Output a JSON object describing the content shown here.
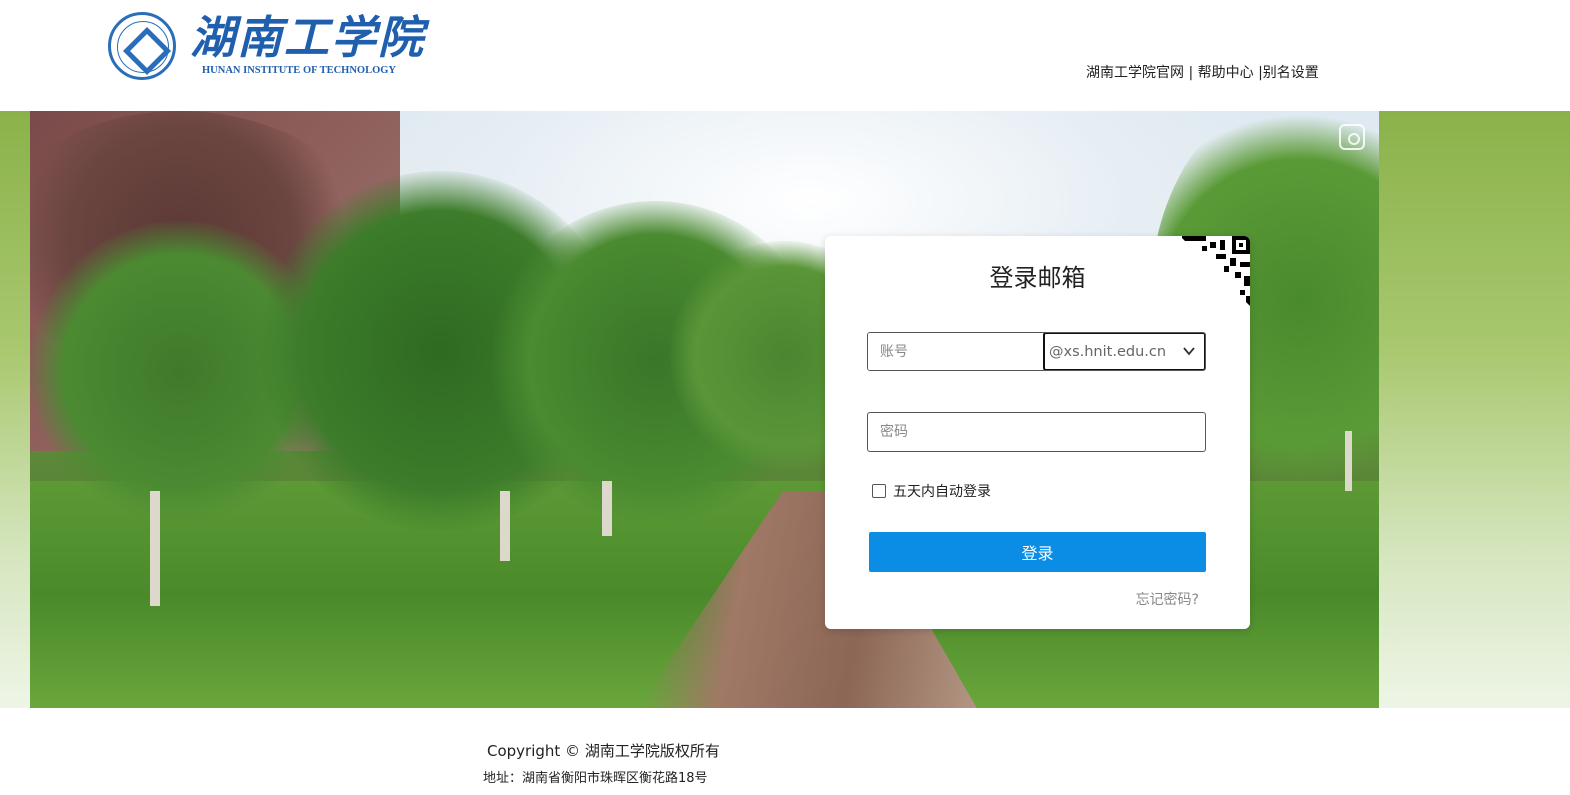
{
  "header": {
    "logo_cn": "湖南工学院",
    "logo_en": "HUNAN INSTITUTE OF TECHNOLOGY",
    "links": {
      "official_site": "湖南工学院官网",
      "sep1": " | ",
      "help_center": "帮助中心",
      "sep2": " |",
      "alias_settings": "别名设置"
    }
  },
  "login": {
    "title": "登录邮箱",
    "account_placeholder": "账号",
    "domain_selected": "@xs.hnit.edu.cn",
    "password_placeholder": "密码",
    "remember_label": "五天内自动登录",
    "login_button": "登录",
    "forgot_password": "忘记密码?"
  },
  "footer": {
    "copyright": "Copyright © 湖南工学院版权所有",
    "address": "地址：湖南省衡阳市珠晖区衡花路18号"
  },
  "colors": {
    "brand_blue": "#1f5fae",
    "button_blue": "#0b8de6",
    "band_green": "#8ab24a"
  },
  "icons": [
    "logo-seal-icon",
    "scan-icon",
    "qr-code-icon",
    "chevron-down-icon"
  ]
}
